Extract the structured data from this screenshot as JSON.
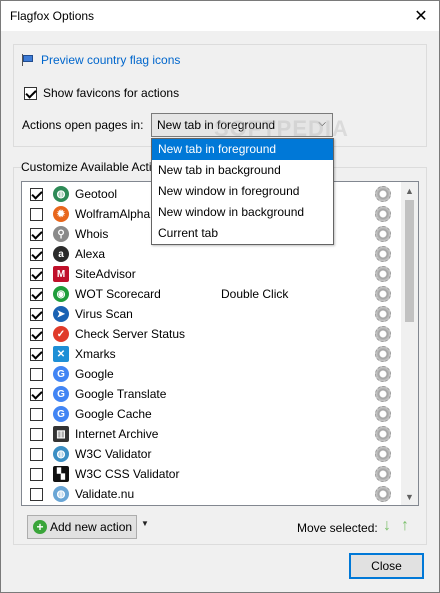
{
  "window": {
    "title": "Flagfox Options",
    "close_glyph": "✕"
  },
  "top": {
    "preview_link": "Preview country flag icons",
    "show_favicons": {
      "label": "Show favicons for actions",
      "checked": true
    },
    "actions_open_label": "Actions open pages in:",
    "actions_open_value": "New tab in foreground",
    "dropdown_options": [
      {
        "label": "New tab in foreground",
        "selected": true
      },
      {
        "label": "New tab in background",
        "selected": false
      },
      {
        "label": "New window in foreground",
        "selected": false
      },
      {
        "label": "New window in background",
        "selected": false
      },
      {
        "label": "Current tab",
        "selected": false
      }
    ]
  },
  "actions_group": {
    "label": "Customize Available Acti",
    "items": [
      {
        "label": "Geotool",
        "checked": true,
        "icon": "globe-icon",
        "color": "#2e8b57",
        "extra": ""
      },
      {
        "label": "WolframAlpha",
        "checked": false,
        "icon": "wolfram-icon",
        "color": "#e8661c",
        "extra": ""
      },
      {
        "label": "Whois",
        "checked": true,
        "icon": "magnifier-icon",
        "color": "#8a8a8a",
        "extra": ""
      },
      {
        "label": "Alexa",
        "checked": true,
        "icon": "alexa-icon",
        "color": "#2b2b2b",
        "extra": ""
      },
      {
        "label": "SiteAdvisor",
        "checked": true,
        "icon": "mcafee-icon",
        "color": "#c0102a",
        "extra": ""
      },
      {
        "label": "WOT Scorecard",
        "checked": true,
        "icon": "wot-icon",
        "color": "#1f9e3b",
        "extra": "Double Click"
      },
      {
        "label": "Virus Scan",
        "checked": true,
        "icon": "virus-scan-icon",
        "color": "#1a62b3",
        "extra": ""
      },
      {
        "label": "Check Server Status",
        "checked": true,
        "icon": "server-status-icon",
        "color": "#e03b2a",
        "extra": ""
      },
      {
        "label": "Xmarks",
        "checked": true,
        "icon": "xmarks-icon",
        "color": "#1e8fd6",
        "extra": ""
      },
      {
        "label": "Google",
        "checked": false,
        "icon": "google-icon",
        "color": "#4285f4",
        "extra": ""
      },
      {
        "label": "Google Translate",
        "checked": true,
        "icon": "google-translate-icon",
        "color": "#4285f4",
        "extra": ""
      },
      {
        "label": "Google Cache",
        "checked": false,
        "icon": "google-cache-icon",
        "color": "#4285f4",
        "extra": ""
      },
      {
        "label": "Internet Archive",
        "checked": false,
        "icon": "archive-icon",
        "color": "#333333",
        "extra": ""
      },
      {
        "label": "W3C Validator",
        "checked": false,
        "icon": "w3c-icon",
        "color": "#3b8fc4",
        "extra": ""
      },
      {
        "label": "W3C CSS Validator",
        "checked": false,
        "icon": "css-validator-icon",
        "color": "#111111",
        "extra": ""
      },
      {
        "label": "Validate.nu",
        "checked": false,
        "icon": "validate-nu-icon",
        "color": "#6aa6d6",
        "extra": ""
      }
    ]
  },
  "bottom": {
    "add_action": "Add new action",
    "move_selected": "Move selected:",
    "close": "Close"
  },
  "watermark": "SOFTPEDIA",
  "accent": "#0078d7"
}
